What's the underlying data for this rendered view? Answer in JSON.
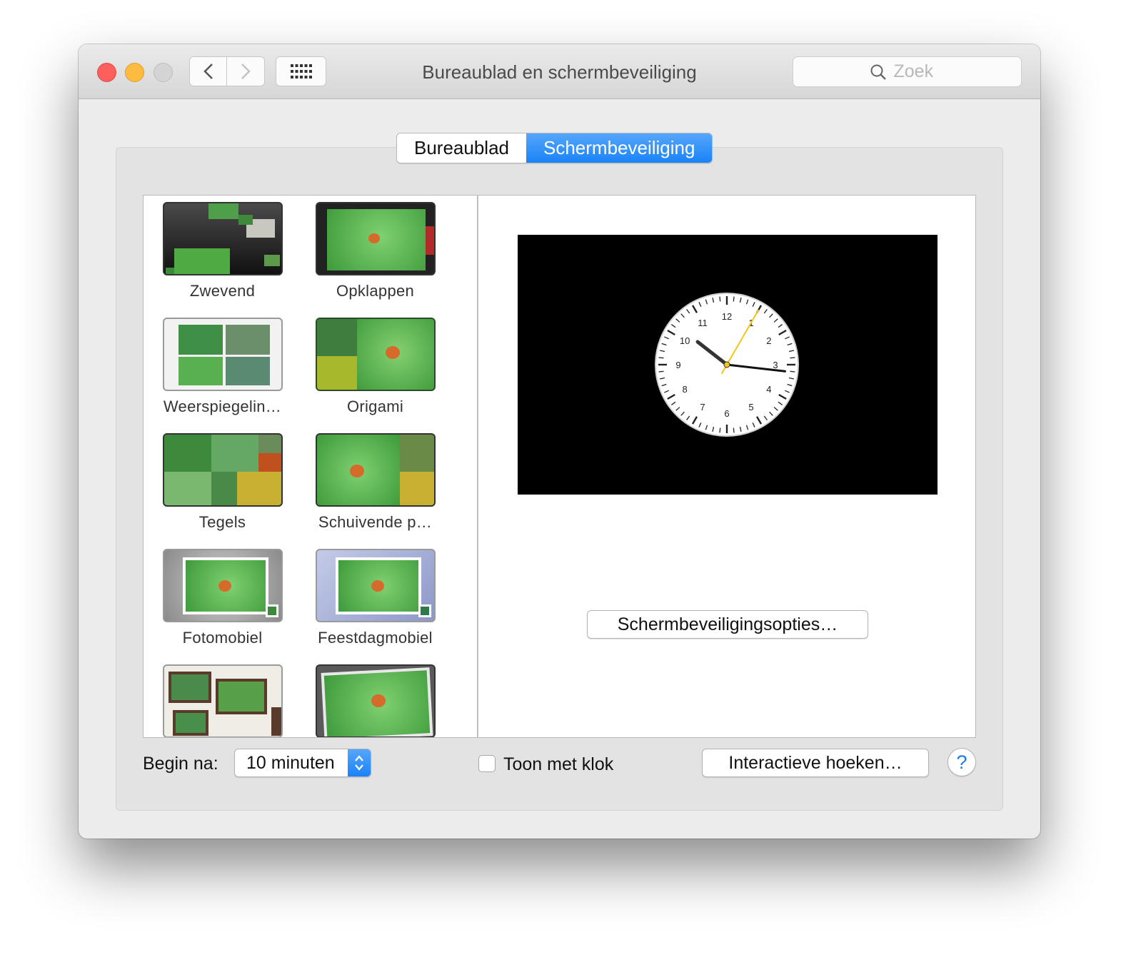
{
  "window": {
    "title": "Bureaublad en schermbeveiliging",
    "search_placeholder": "Zoek"
  },
  "tabs": [
    {
      "label": "Bureaublad",
      "selected": false
    },
    {
      "label": "Schermbeveiliging",
      "selected": true
    }
  ],
  "screensavers": [
    {
      "label": "Zwevend"
    },
    {
      "label": "Opklappen"
    },
    {
      "label": "Weerspiegelin…"
    },
    {
      "label": "Origami"
    },
    {
      "label": "Tegels"
    },
    {
      "label": "Schuivende p…"
    },
    {
      "label": "Fotomobiel"
    },
    {
      "label": "Feestdagmobiel"
    }
  ],
  "preview": {
    "clock": {
      "numbers": [
        "12",
        "1",
        "2",
        "3",
        "4",
        "5",
        "6",
        "7",
        "8",
        "9",
        "10",
        "11"
      ],
      "hour": 10,
      "minute": 16,
      "second": 5
    },
    "options_button": "Schermbeveiligingsopties…"
  },
  "footer": {
    "begin_label": "Begin na:",
    "begin_value": "10 minuten",
    "show_clock_label": "Toon met klok",
    "show_clock_checked": false,
    "corners_button": "Interactieve hoeken…",
    "help_label": "?"
  },
  "colors": {
    "accent": "#1a83f7",
    "close": "#fc605c",
    "minimize": "#fdbc40",
    "zoom_disabled": "#d4d4d4",
    "second_hand": "#f5c518"
  },
  "icons": [
    "chevron-left-icon",
    "chevron-right-icon",
    "grid-icon",
    "search-icon",
    "stepper-icon",
    "help-icon"
  ]
}
